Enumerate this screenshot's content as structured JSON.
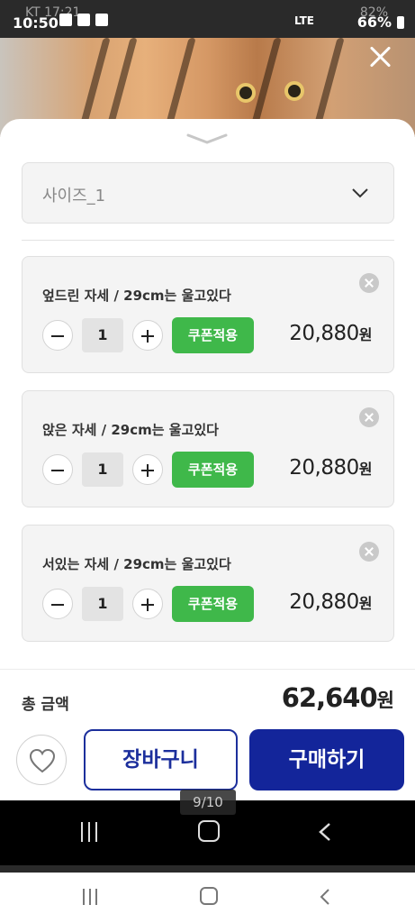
{
  "status_bar": {
    "time": "10:50",
    "under_carrier": "KT 17:21",
    "under_battery": "82%",
    "signal_text": "LTE",
    "battery": "66%"
  },
  "photo": {
    "alt": "tiger-plush-photo"
  },
  "size_select": {
    "label": "사이즈_1"
  },
  "options": [
    {
      "title": "엎드린 자세 / 29cm는 울고있다",
      "quantity": "1",
      "coupon_label": "쿠폰적용",
      "price": "20,880",
      "price_unit": "원"
    },
    {
      "title": "앉은 자세 / 29cm는 울고있다",
      "quantity": "1",
      "coupon_label": "쿠폰적용",
      "price": "20,880",
      "price_unit": "원"
    },
    {
      "title": "서있는 자세 / 29cm는 울고있다",
      "quantity": "1",
      "coupon_label": "쿠폰적용",
      "price": "20,880",
      "price_unit": "원"
    }
  ],
  "total": {
    "label": "총 금액",
    "value": "62,640",
    "unit": "원"
  },
  "buttons": {
    "cart": "장바구니",
    "buy": "구매하기"
  },
  "page_indicator": "9/10",
  "colors": {
    "coupon": "#3fb84a",
    "primary": "#13259a"
  }
}
